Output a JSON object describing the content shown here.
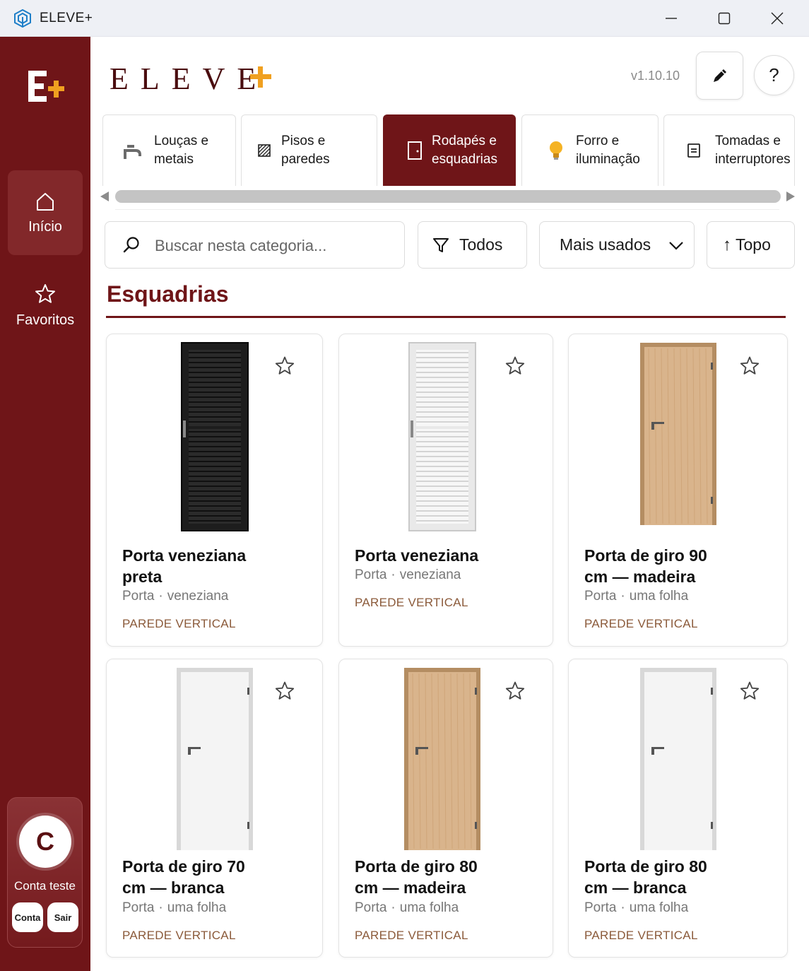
{
  "window": {
    "title": "ELEVE+"
  },
  "brand": {
    "name": "ELEVE",
    "plus": "+",
    "version": "v1.10.10",
    "help_label": "?"
  },
  "sidebar": {
    "items": [
      {
        "label": "Início",
        "icon": "home-icon",
        "active": true
      },
      {
        "label": "Favoritos",
        "icon": "star-icon",
        "active": false
      }
    ],
    "account": {
      "initial": "C",
      "name": "Conta teste",
      "account_label": "Conta",
      "logout_label": "Sair"
    }
  },
  "categories": [
    {
      "line1": "Louças e",
      "line2": "metais",
      "icon": "faucet-icon",
      "active": false
    },
    {
      "line1": "Pisos e paredes",
      "line2": "",
      "icon": "tiles-icon",
      "active": false
    },
    {
      "line1": "Rodapés e",
      "line2": "esquadrias",
      "icon": "door-icon",
      "active": true
    },
    {
      "line1": "Forro e",
      "line2": "iluminação",
      "icon": "bulb-icon",
      "active": false
    },
    {
      "line1": "Tomadas e",
      "line2": "interruptores",
      "icon": "outlet-icon",
      "active": false
    }
  ],
  "toolbar": {
    "search_placeholder": "Buscar nesta categoria...",
    "filter_label": "Todos",
    "sort_label": "Mais usados",
    "top_label": "Topo"
  },
  "section": {
    "title": "Esquadrias"
  },
  "products": [
    {
      "title_line1": "Porta veneziana",
      "title_line2": "preta",
      "category": "Porta",
      "type": "veneziana",
      "tag": "PAREDE VERTICAL",
      "door": "louver-black"
    },
    {
      "title_line1": "Porta veneziana",
      "title_line2": "",
      "category": "Porta",
      "type": "veneziana",
      "tag": "PAREDE VERTICAL",
      "door": "louver-white"
    },
    {
      "title_line1": "Porta de giro 90",
      "title_line2": "cm — madeira",
      "category": "Porta",
      "type": "uma folha",
      "tag": "PAREDE VERTICAL",
      "door": "wood"
    },
    {
      "title_line1": "Porta de giro 70",
      "title_line2": "cm — branca",
      "category": "Porta",
      "type": "uma folha",
      "tag": "PAREDE VERTICAL",
      "door": "white"
    },
    {
      "title_line1": "Porta de giro 80",
      "title_line2": "cm — madeira",
      "category": "Porta",
      "type": "uma folha",
      "tag": "PAREDE VERTICAL",
      "door": "wood"
    },
    {
      "title_line1": "Porta de giro 80",
      "title_line2": "cm — branca",
      "category": "Porta",
      "type": "uma folha",
      "tag": "PAREDE VERTICAL",
      "door": "white"
    }
  ],
  "colors": {
    "primary": "#6f1518",
    "accent": "#f0a020",
    "tag": "#8b5a3a"
  }
}
